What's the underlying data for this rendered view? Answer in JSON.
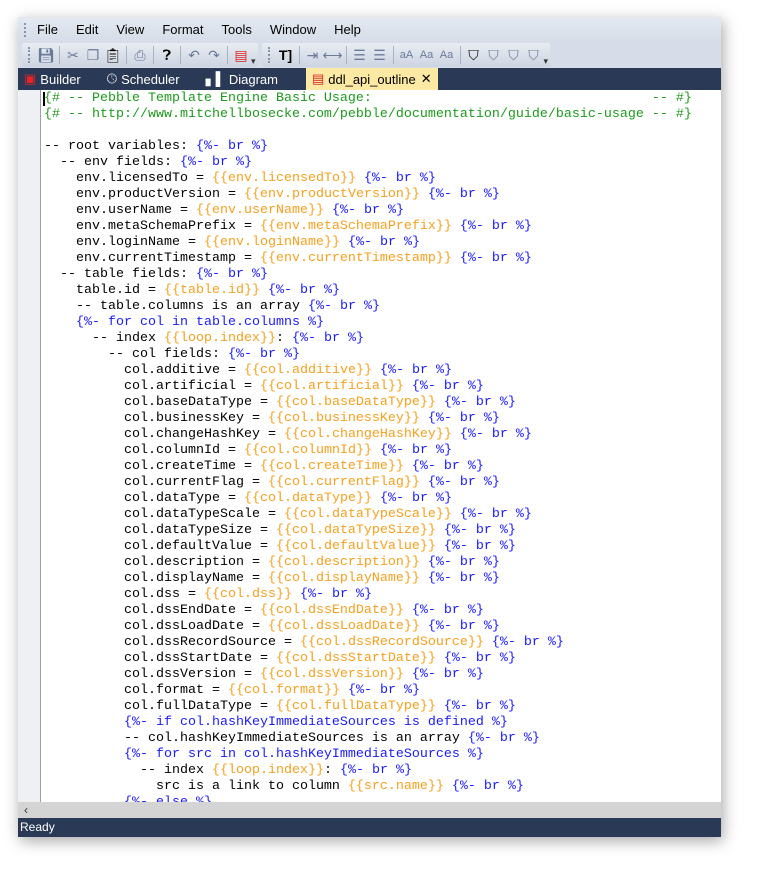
{
  "menu": [
    "File",
    "Edit",
    "View",
    "Format",
    "Tools",
    "Window",
    "Help"
  ],
  "tabs": [
    {
      "label": "Builder",
      "icon": "builder-icon"
    },
    {
      "label": "Scheduler",
      "icon": "clock-icon"
    },
    {
      "label": "Diagram",
      "icon": "bar-chart-icon"
    },
    {
      "label": "ddl_api_outline",
      "icon": "document-icon",
      "active": true,
      "close": "✕"
    }
  ],
  "status": "Ready",
  "colors": {
    "comment": "#1d9a1d",
    "variable": "#f5a01e",
    "tag": "#1a1aff",
    "tabbar": "#293956",
    "active_tab": "#fce9a4"
  },
  "code": [
    [
      [
        "g",
        "{# -- Pebble Template Engine Basic Usage:                                   -- #}"
      ]
    ],
    [
      [
        "g",
        "{# -- http://www.mitchellbosecke.com/pebble/documentation/guide/basic-usage -- #}"
      ]
    ],
    [],
    [
      [
        "k",
        "-- root variables: "
      ],
      [
        "b",
        "{%- br %}"
      ]
    ],
    [
      [
        "k",
        "  -- env fields: "
      ],
      [
        "b",
        "{%- br %}"
      ]
    ],
    [
      [
        "k",
        "    env.licensedTo = "
      ],
      [
        "o",
        "{{env.licensedTo}}"
      ],
      [
        "k",
        " "
      ],
      [
        "b",
        "{%- br %}"
      ]
    ],
    [
      [
        "k",
        "    env.productVersion = "
      ],
      [
        "o",
        "{{env.productVersion}}"
      ],
      [
        "k",
        " "
      ],
      [
        "b",
        "{%- br %}"
      ]
    ],
    [
      [
        "k",
        "    env.userName = "
      ],
      [
        "o",
        "{{env.userName}}"
      ],
      [
        "k",
        " "
      ],
      [
        "b",
        "{%- br %}"
      ]
    ],
    [
      [
        "k",
        "    env.metaSchemaPrefix = "
      ],
      [
        "o",
        "{{env.metaSchemaPrefix}}"
      ],
      [
        "k",
        " "
      ],
      [
        "b",
        "{%- br %}"
      ]
    ],
    [
      [
        "k",
        "    env.loginName = "
      ],
      [
        "o",
        "{{env.loginName}}"
      ],
      [
        "k",
        " "
      ],
      [
        "b",
        "{%- br %}"
      ]
    ],
    [
      [
        "k",
        "    env.currentTimestamp = "
      ],
      [
        "o",
        "{{env.currentTimestamp}}"
      ],
      [
        "k",
        " "
      ],
      [
        "b",
        "{%- br %}"
      ]
    ],
    [
      [
        "k",
        "  -- table fields: "
      ],
      [
        "b",
        "{%- br %}"
      ]
    ],
    [
      [
        "k",
        "    table.id = "
      ],
      [
        "o",
        "{{table.id}}"
      ],
      [
        "k",
        " "
      ],
      [
        "b",
        "{%- br %}"
      ]
    ],
    [
      [
        "k",
        "    -- table.columns is an array "
      ],
      [
        "b",
        "{%- br %}"
      ]
    ],
    [
      [
        "b",
        "    {%- for col in table.columns %}"
      ]
    ],
    [
      [
        "k",
        "      -- index "
      ],
      [
        "o",
        "{{loop.index}}"
      ],
      [
        "k",
        ": "
      ],
      [
        "b",
        "{%- br %}"
      ]
    ],
    [
      [
        "k",
        "        -- col fields: "
      ],
      [
        "b",
        "{%- br %}"
      ]
    ],
    [
      [
        "k",
        "          col.additive = "
      ],
      [
        "o",
        "{{col.additive}}"
      ],
      [
        "k",
        " "
      ],
      [
        "b",
        "{%- br %}"
      ]
    ],
    [
      [
        "k",
        "          col.artificial = "
      ],
      [
        "o",
        "{{col.artificial}}"
      ],
      [
        "k",
        " "
      ],
      [
        "b",
        "{%- br %}"
      ]
    ],
    [
      [
        "k",
        "          col.baseDataType = "
      ],
      [
        "o",
        "{{col.baseDataType}}"
      ],
      [
        "k",
        " "
      ],
      [
        "b",
        "{%- br %}"
      ]
    ],
    [
      [
        "k",
        "          col.businessKey = "
      ],
      [
        "o",
        "{{col.businessKey}}"
      ],
      [
        "k",
        " "
      ],
      [
        "b",
        "{%- br %}"
      ]
    ],
    [
      [
        "k",
        "          col.changeHashKey = "
      ],
      [
        "o",
        "{{col.changeHashKey}}"
      ],
      [
        "k",
        " "
      ],
      [
        "b",
        "{%- br %}"
      ]
    ],
    [
      [
        "k",
        "          col.columnId = "
      ],
      [
        "o",
        "{{col.columnId}}"
      ],
      [
        "k",
        " "
      ],
      [
        "b",
        "{%- br %}"
      ]
    ],
    [
      [
        "k",
        "          col.createTime = "
      ],
      [
        "o",
        "{{col.createTime}}"
      ],
      [
        "k",
        " "
      ],
      [
        "b",
        "{%- br %}"
      ]
    ],
    [
      [
        "k",
        "          col.currentFlag = "
      ],
      [
        "o",
        "{{col.currentFlag}}"
      ],
      [
        "k",
        " "
      ],
      [
        "b",
        "{%- br %}"
      ]
    ],
    [
      [
        "k",
        "          col.dataType = "
      ],
      [
        "o",
        "{{col.dataType}}"
      ],
      [
        "k",
        " "
      ],
      [
        "b",
        "{%- br %}"
      ]
    ],
    [
      [
        "k",
        "          col.dataTypeScale = "
      ],
      [
        "o",
        "{{col.dataTypeScale}}"
      ],
      [
        "k",
        " "
      ],
      [
        "b",
        "{%- br %}"
      ]
    ],
    [
      [
        "k",
        "          col.dataTypeSize = "
      ],
      [
        "o",
        "{{col.dataTypeSize}}"
      ],
      [
        "k",
        " "
      ],
      [
        "b",
        "{%- br %}"
      ]
    ],
    [
      [
        "k",
        "          col.defaultValue = "
      ],
      [
        "o",
        "{{col.defaultValue}}"
      ],
      [
        "k",
        " "
      ],
      [
        "b",
        "{%- br %}"
      ]
    ],
    [
      [
        "k",
        "          col.description = "
      ],
      [
        "o",
        "{{col.description}}"
      ],
      [
        "k",
        " "
      ],
      [
        "b",
        "{%- br %}"
      ]
    ],
    [
      [
        "k",
        "          col.displayName = "
      ],
      [
        "o",
        "{{col.displayName}}"
      ],
      [
        "k",
        " "
      ],
      [
        "b",
        "{%- br %}"
      ]
    ],
    [
      [
        "k",
        "          col.dss = "
      ],
      [
        "o",
        "{{col.dss}}"
      ],
      [
        "k",
        " "
      ],
      [
        "b",
        "{%- br %}"
      ]
    ],
    [
      [
        "k",
        "          col.dssEndDate = "
      ],
      [
        "o",
        "{{col.dssEndDate}}"
      ],
      [
        "k",
        " "
      ],
      [
        "b",
        "{%- br %}"
      ]
    ],
    [
      [
        "k",
        "          col.dssLoadDate = "
      ],
      [
        "o",
        "{{col.dssLoadDate}}"
      ],
      [
        "k",
        " "
      ],
      [
        "b",
        "{%- br %}"
      ]
    ],
    [
      [
        "k",
        "          col.dssRecordSource = "
      ],
      [
        "o",
        "{{col.dssRecordSource}}"
      ],
      [
        "k",
        " "
      ],
      [
        "b",
        "{%- br %}"
      ]
    ],
    [
      [
        "k",
        "          col.dssStartDate = "
      ],
      [
        "o",
        "{{col.dssStartDate}}"
      ],
      [
        "k",
        " "
      ],
      [
        "b",
        "{%- br %}"
      ]
    ],
    [
      [
        "k",
        "          col.dssVersion = "
      ],
      [
        "o",
        "{{col.dssVersion}}"
      ],
      [
        "k",
        " "
      ],
      [
        "b",
        "{%- br %}"
      ]
    ],
    [
      [
        "k",
        "          col.format = "
      ],
      [
        "o",
        "{{col.format}}"
      ],
      [
        "k",
        " "
      ],
      [
        "b",
        "{%- br %}"
      ]
    ],
    [
      [
        "k",
        "          col.fullDataType = "
      ],
      [
        "o",
        "{{col.fullDataType}}"
      ],
      [
        "k",
        " "
      ],
      [
        "b",
        "{%- br %}"
      ]
    ],
    [
      [
        "b",
        "          {%- if col.hashKeyImmediateSources is defined %}"
      ]
    ],
    [
      [
        "k",
        "          -- col.hashKeyImmediateSources is an array "
      ],
      [
        "b",
        "{%- br %}"
      ]
    ],
    [
      [
        "b",
        "          {%- for src in col.hashKeyImmediateSources %}"
      ]
    ],
    [
      [
        "k",
        "            -- index "
      ],
      [
        "o",
        "{{loop.index}}"
      ],
      [
        "k",
        ": "
      ],
      [
        "b",
        "{%- br %}"
      ]
    ],
    [
      [
        "k",
        "              src is a link to column "
      ],
      [
        "o",
        "{{src.name}}"
      ],
      [
        "k",
        " "
      ],
      [
        "b",
        "{%- br %}"
      ]
    ],
    [
      [
        "b",
        "          {%- else %}"
      ]
    ]
  ]
}
